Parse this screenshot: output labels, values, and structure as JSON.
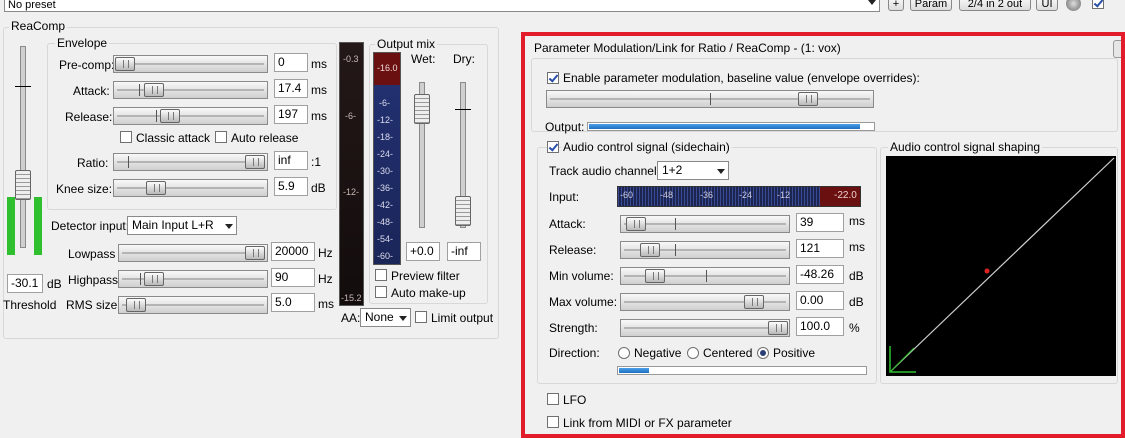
{
  "header": {
    "preset": "No preset",
    "plus_label": "+",
    "param_label": "Param",
    "io_label": "2/4 in 2 out",
    "ui_label": "UI"
  },
  "comp": {
    "title": "ReaComp",
    "envelope": {
      "title": "Envelope",
      "precomp": {
        "label": "Pre-comp:",
        "value": "0",
        "unit": "ms"
      },
      "attack": {
        "label": "Attack:",
        "value": "17.4",
        "unit": "ms"
      },
      "release": {
        "label": "Release:",
        "value": "197",
        "unit": "ms"
      },
      "classic_attack": "Classic attack",
      "auto_release": "Auto release"
    },
    "ratio": {
      "label": "Ratio:",
      "value": "inf",
      "unit": ":1"
    },
    "knee": {
      "label": "Knee size:",
      "value": "5.9",
      "unit": "dB"
    },
    "detector": {
      "label": "Detector input:",
      "value": "Main Input L+R"
    },
    "lowpass": {
      "label": "Lowpass",
      "value": "20000",
      "unit": "Hz"
    },
    "highpass": {
      "label": "Highpass",
      "value": "90",
      "unit": "Hz"
    },
    "rms": {
      "label": "RMS size",
      "value": "5.0",
      "unit": "ms"
    },
    "threshold": {
      "value": "-30.1",
      "unit": "dB",
      "label": "Threshold"
    },
    "meter": {
      "labels": [
        "-0.3",
        "-6-",
        "-12-",
        "-15.2"
      ]
    },
    "output": {
      "title": "Output mix",
      "wet": "Wet:",
      "dry": "Dry:",
      "scale": [
        "-16.0",
        "-6-",
        "-12-",
        "-18-",
        "-24-",
        "-30-",
        "-36-",
        "-42-",
        "-48-",
        "-54-",
        "-60-"
      ],
      "wet_value": "+0.0",
      "dry_value": "-inf",
      "preview_filter": "Preview filter",
      "auto_makeup": "Auto make-up"
    },
    "aa": {
      "label": "AA:",
      "value": "None"
    },
    "limit_output": "Limit output"
  },
  "mod": {
    "title": "Parameter Modulation/Link for Ratio / ReaComp - (1: vox)",
    "enable_label": "Enable parameter modulation, baseline value (envelope overrides):",
    "output_label": "Output:",
    "audio_signal_label": "Audio control signal (sidechain)",
    "track_channel": {
      "label": "Track audio channel:",
      "value": "1+2"
    },
    "input": {
      "label": "Input:",
      "scale": [
        "-60",
        "-48",
        "-36",
        "-24",
        "-12"
      ],
      "peak": "-22.0"
    },
    "attack": {
      "label": "Attack:",
      "value": "39",
      "unit": "ms"
    },
    "release": {
      "label": "Release:",
      "value": "121",
      "unit": "ms"
    },
    "min_volume": {
      "label": "Min volume:",
      "value": "-48.26",
      "unit": "dB"
    },
    "max_volume": {
      "label": "Max volume:",
      "value": "0.00",
      "unit": "dB"
    },
    "strength": {
      "label": "Strength:",
      "value": "100.0",
      "unit": "%"
    },
    "direction": {
      "label": "Direction:",
      "options": [
        "Negative",
        "Centered",
        "Positive"
      ],
      "selected": "Positive"
    },
    "shaping_label": "Audio control signal shaping",
    "lfo_label": "LFO",
    "link_label": "Link from MIDI or FX parameter"
  },
  "colors": {
    "highlight": "#e21c2a",
    "meter_dark": "#1c2450",
    "peak": "#6a1010"
  }
}
